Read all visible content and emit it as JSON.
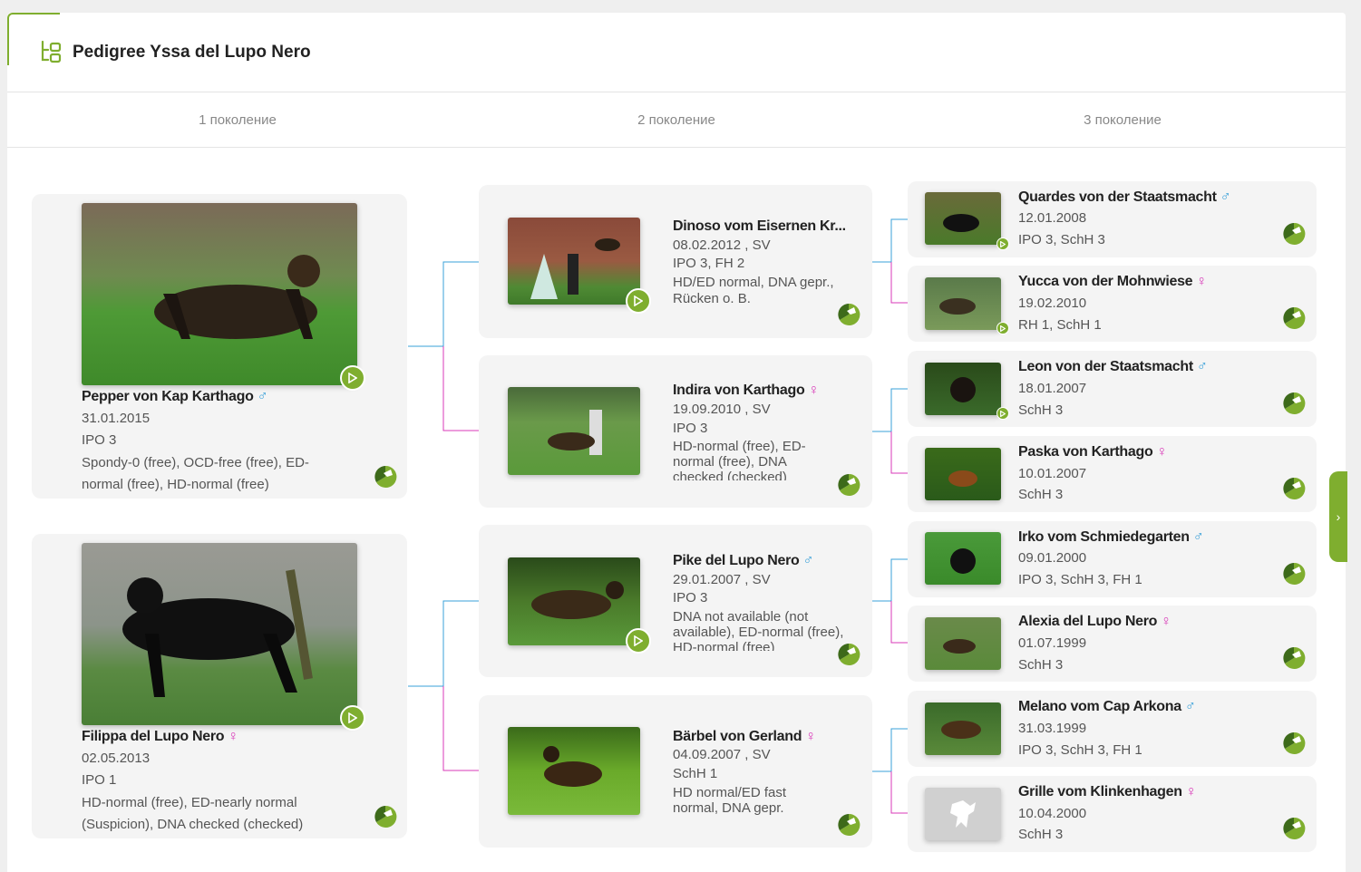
{
  "title": "Pedigree Yssa del Lupo Nero",
  "generations": [
    "1 поколение",
    "2 поколение",
    "3 поколение"
  ],
  "colors": {
    "accent": "#7fae2f",
    "male_line": "#3aa0d8",
    "female_line": "#d83ab8"
  },
  "gen1": [
    {
      "name": "Pepper von Kap Karthago",
      "sex": "♂",
      "date": "31.01.2015",
      "titles": "IPO 3",
      "health": "Spondy-0 (free), OCD-free (free), ED-normal (free), HD-normal (free)"
    },
    {
      "name": "Filippa del Lupo Nero",
      "sex": "♀",
      "date": "02.05.2013",
      "titles": "IPO 1",
      "health": "HD-normal (free), ED-nearly normal (Suspicion), DNA checked (checked)"
    }
  ],
  "gen2": [
    {
      "name": "Dinoso vom Eisernen Kr...",
      "sex": "",
      "date": "08.02.2012 , SV",
      "titles": "IPO 3, FH 2",
      "health": "HD/ED normal, DNA gepr., Rücken o. B."
    },
    {
      "name": "Indira von Karthago",
      "sex": "♀",
      "date": "19.09.2010 , SV",
      "titles": "IPO 3",
      "health": "HD-normal (free), ED-normal (free), DNA checked (checked)"
    },
    {
      "name": "Pike del Lupo Nero",
      "sex": "♂",
      "date": "29.01.2007 , SV",
      "titles": "IPO 3",
      "health": "DNA not available (not available), ED-normal (free), HD-normal (free)"
    },
    {
      "name": "Bärbel von Gerland",
      "sex": "♀",
      "date": "04.09.2007 , SV",
      "titles": "SchH 1",
      "health": "HD normal/ED fast normal, DNA gepr."
    }
  ],
  "gen3": [
    {
      "name": "Quardes von der Staatsmacht",
      "sex": "♂",
      "date": "12.01.2008",
      "titles": "IPO 3, SchH 3"
    },
    {
      "name": "Yucca von der Mohnwiese",
      "sex": "♀",
      "date": "19.02.2010",
      "titles": "RH 1, SchH 1"
    },
    {
      "name": "Leon von der Staatsmacht",
      "sex": "♂",
      "date": "18.01.2007",
      "titles": "SchH 3"
    },
    {
      "name": "Paska von Karthago",
      "sex": "♀",
      "date": "10.01.2007",
      "titles": "SchH 3"
    },
    {
      "name": "Irko vom Schmiedegarten",
      "sex": "♂",
      "date": "09.01.2000",
      "titles": "IPO 3, SchH 3, FH 1"
    },
    {
      "name": "Alexia del Lupo Nero",
      "sex": "♀",
      "date": "01.07.1999",
      "titles": "SchH 3"
    },
    {
      "name": "Melano vom Cap Arkona",
      "sex": "♂",
      "date": "31.03.1999",
      "titles": "IPO 3, SchH 3, FH 1"
    },
    {
      "name": "Grille vom Klinkenhagen",
      "sex": "♀",
      "date": "10.04.2000",
      "titles": "SchH 3"
    }
  ],
  "side_tab": "›"
}
